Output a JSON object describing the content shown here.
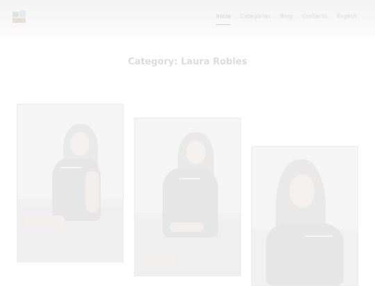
{
  "header": {
    "nav": [
      {
        "label": "Inicio",
        "active": true
      },
      {
        "label": "Categorías",
        "active": false
      },
      {
        "label": "Blog",
        "active": false
      },
      {
        "label": "Contacto",
        "active": false
      },
      {
        "label": "English",
        "active": false
      }
    ]
  },
  "main": {
    "title": "Category: Laura Robles"
  },
  "colors": {
    "background": "#ffffff",
    "header": "#f5f5f5",
    "text_muted": "#dcdcdc"
  }
}
